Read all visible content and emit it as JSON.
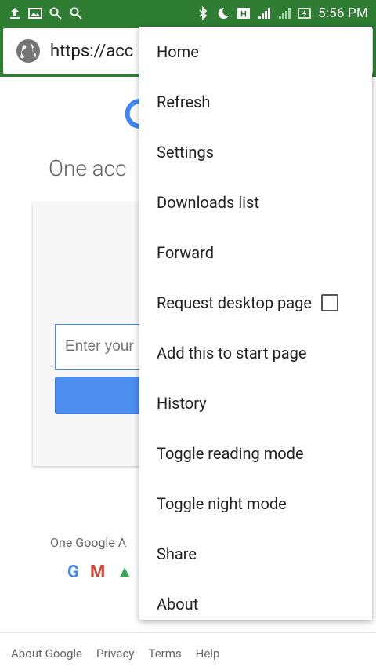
{
  "status_bar": {
    "time": "5:56 PM",
    "icons_left": [
      "upload-icon",
      "image-icon",
      "search-icon",
      "search-icon"
    ],
    "icons_right": [
      "bluetooth-icon",
      "do-not-disturb-icon",
      "h-network-icon",
      "signal-sim1-icon",
      "signal-sim2-icon",
      "battery-charging-icon"
    ],
    "color": "#2e7d32"
  },
  "url_bar": {
    "url": "https://acc"
  },
  "page": {
    "heading": "One acc",
    "email_placeholder": "Enter your",
    "footer_brand": "One Google A",
    "footer_links": [
      "About Google",
      "Privacy",
      "Terms",
      "Help"
    ]
  },
  "menu": {
    "items": [
      {
        "label": "Home"
      },
      {
        "label": "Refresh"
      },
      {
        "label": "Settings"
      },
      {
        "label": "Downloads list"
      },
      {
        "label": "Forward"
      },
      {
        "label": "Request desktop page",
        "checkbox": true
      },
      {
        "label": "Add this to start page"
      },
      {
        "label": "History"
      },
      {
        "label": "Toggle reading mode"
      },
      {
        "label": "Toggle night mode"
      },
      {
        "label": "Share"
      },
      {
        "label": "About"
      }
    ]
  }
}
